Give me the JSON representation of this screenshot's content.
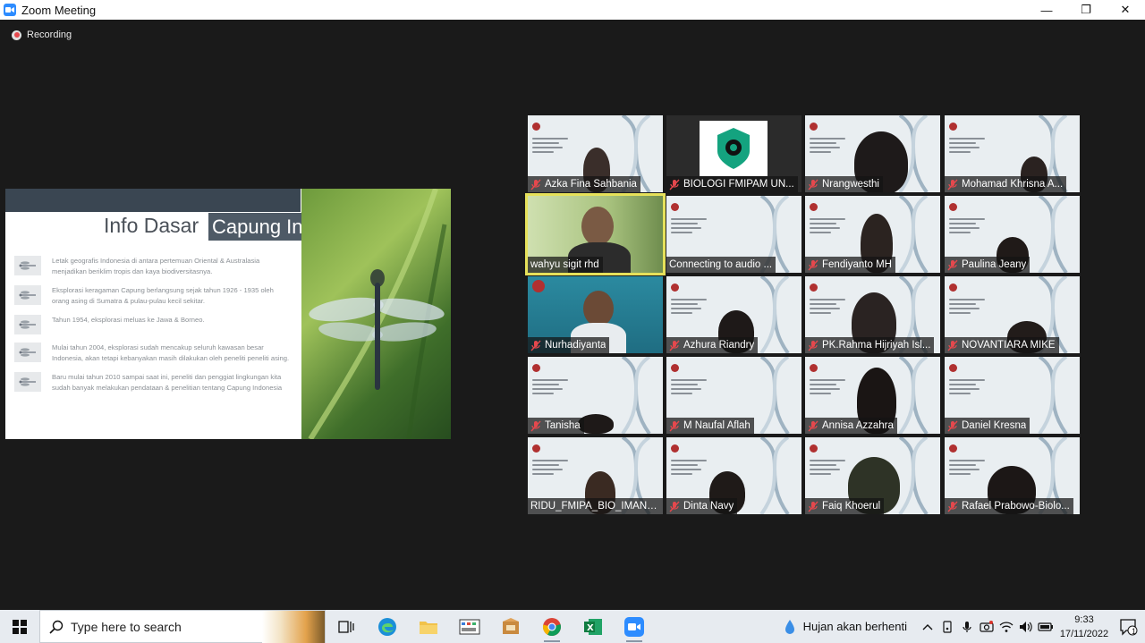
{
  "window": {
    "title": "Zoom Meeting",
    "minimize_glyph": "—",
    "restore_glyph": "❐",
    "close_glyph": "✕"
  },
  "meeting": {
    "recording_label": "Recording",
    "recording_color": "#e5484d"
  },
  "slide": {
    "title_plain": "Info Dasar",
    "title_highlight": "Capung Indonesia",
    "bullets": [
      "Letak geografis Indonesia di antara pertemuan Oriental & Australasia menjadikan beriklim tropis dan kaya biodiversitasnya.",
      "Eksplorasi keragaman Capung berlangsung sejak tahun 1926 - 1935 oleh orang asing di Sumatra & pulau-pulau kecil sekitar.",
      "Tahun 1954, eksplorasi meluas ke Jawa & Borneo.",
      "Mulai tahun 2004, eksplorasi sudah mencakup seluruh kawasan besar Indonesia, akan tetapi kebanyakan masih dilakukan oleh peneliti peneliti asing.",
      "Baru mulai tahun 2010 sampai saat ini, peneliti dan penggiat lingkungan kita sudah banyak melakukan pendataan & penelitian tentang Capung Indonesia"
    ]
  },
  "gallery": {
    "active_color": "#e6e15a",
    "participants": [
      {
        "name": "Azka Fina Sahbania",
        "kind": "slide-person"
      },
      {
        "name": "BIOLOGI FMIPAM UN...",
        "kind": "logo"
      },
      {
        "name": "Nrangwesthi",
        "kind": "slide-person"
      },
      {
        "name": "Mohamad Khrisna A...",
        "kind": "slide-person"
      },
      {
        "name": "wahyu sigit rhd",
        "kind": "camera",
        "active": true
      },
      {
        "name": "Connecting to audio ...",
        "kind": "slide"
      },
      {
        "name": "Fendiyanto MH",
        "kind": "slide-person"
      },
      {
        "name": "Paulina Jeany",
        "kind": "slide-person"
      },
      {
        "name": "Nurhadiyanta",
        "kind": "camera-teal"
      },
      {
        "name": "Azhura Riandry",
        "kind": "slide-person"
      },
      {
        "name": "PK.Rahma Hijriyah Isl...",
        "kind": "slide-person"
      },
      {
        "name": "NOVANTIARA MIKE",
        "kind": "slide-person"
      },
      {
        "name": "Tanisha",
        "kind": "slide-person"
      },
      {
        "name": "M Naufal Aflah",
        "kind": "slide"
      },
      {
        "name": "Annisa Azzahra",
        "kind": "slide-person"
      },
      {
        "name": "Daniel Kresna",
        "kind": "slide"
      },
      {
        "name": "RIDU_FMIPA_BIO_IMANU...",
        "kind": "slide-person"
      },
      {
        "name": "Dinta Navy",
        "kind": "slide-person"
      },
      {
        "name": "Faiq Khoerul",
        "kind": "slide-person"
      },
      {
        "name": "Rafael Prabowo-Biolo...",
        "kind": "slide-person"
      }
    ]
  },
  "taskbar": {
    "search_placeholder": "Type here to search",
    "weather_text": "Hujan akan berhenti",
    "time": "9:33",
    "date": "17/11/2022",
    "notification_count": "1"
  }
}
